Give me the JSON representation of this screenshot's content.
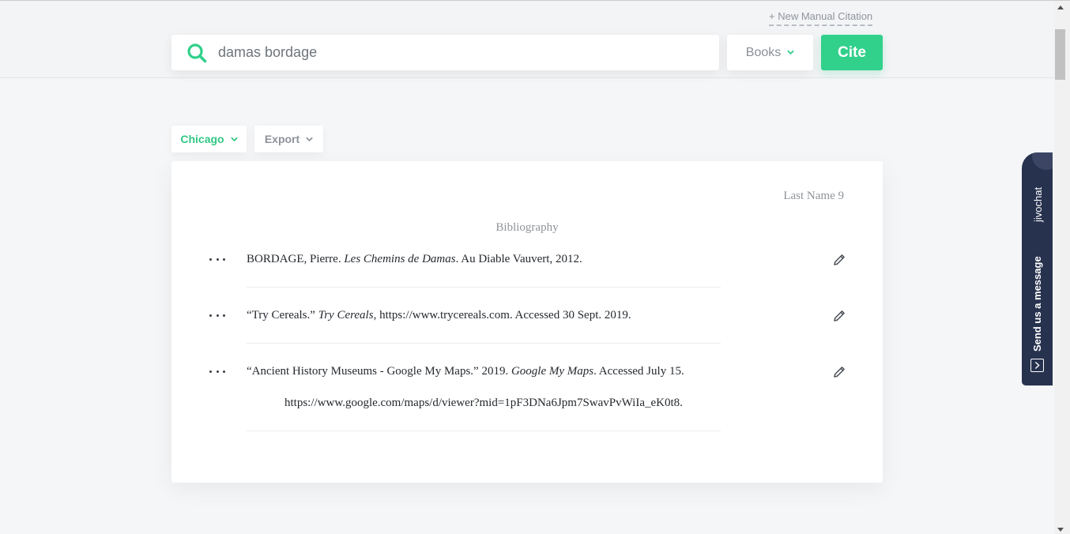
{
  "header": {
    "manual_link": "+ New Manual Citation",
    "search": {
      "value": "damas bordage",
      "icon": "search-icon"
    },
    "source_type": "Books",
    "cite_label": "Cite"
  },
  "toolbar": {
    "style_label": "Chicago",
    "export_label": "Export"
  },
  "paper": {
    "page_header": "Last Name 9",
    "title": "Bibliography",
    "entries": [
      {
        "line1_pre": "BORDAGE, Pierre. ",
        "line1_italic": "Les Chemins de Damas",
        "line1_post": ". Au Diable Vauvert, 2012."
      },
      {
        "line1_pre": "“Try Cereals.” ",
        "line1_italic": "Try Cereals",
        "line1_post": ", https://www.trycereals.com. Accessed 30 Sept. 2019."
      },
      {
        "line1_pre": "“Ancient History Museums - Google My Maps.” 2019. ",
        "line1_italic": "Google My Maps",
        "line1_post": ". Accessed July 15.",
        "line2": "https://www.google.com/maps/d/viewer?mid=1pF3DNa6Jpm7SwavPvWiIa_eK0t8."
      }
    ]
  },
  "chat": {
    "brand": "jivochat",
    "message": "Send us a message"
  },
  "colors": {
    "accent": "#31d08b",
    "background": "#f5f6f8",
    "chat_bg": "#27324f"
  }
}
